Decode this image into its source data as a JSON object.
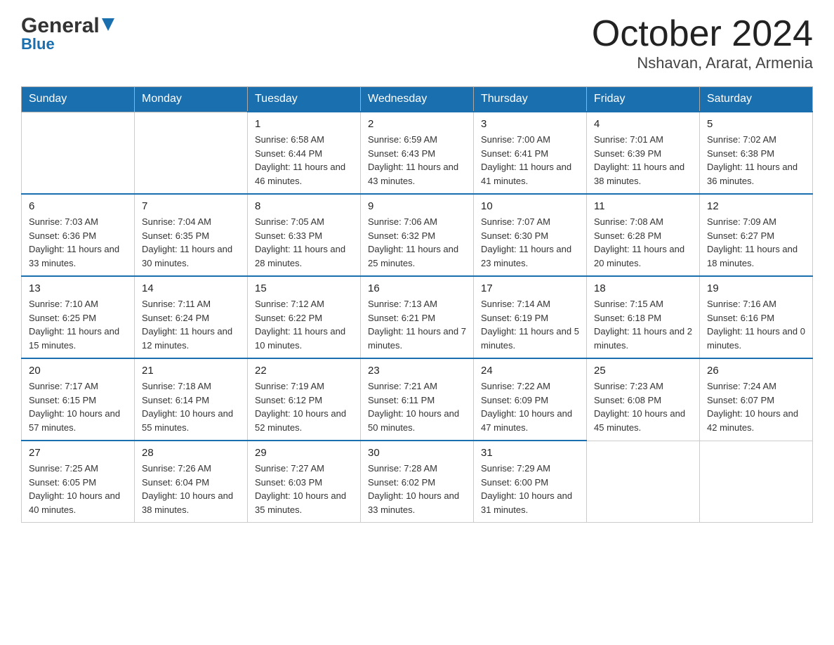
{
  "header": {
    "logo_general": "General",
    "logo_blue": "Blue",
    "month_title": "October 2024",
    "location": "Nshavan, Ararat, Armenia"
  },
  "weekdays": [
    "Sunday",
    "Monday",
    "Tuesday",
    "Wednesday",
    "Thursday",
    "Friday",
    "Saturday"
  ],
  "weeks": [
    [
      {
        "day": "",
        "sunrise": "",
        "sunset": "",
        "daylight": ""
      },
      {
        "day": "",
        "sunrise": "",
        "sunset": "",
        "daylight": ""
      },
      {
        "day": "1",
        "sunrise": "Sunrise: 6:58 AM",
        "sunset": "Sunset: 6:44 PM",
        "daylight": "Daylight: 11 hours and 46 minutes."
      },
      {
        "day": "2",
        "sunrise": "Sunrise: 6:59 AM",
        "sunset": "Sunset: 6:43 PM",
        "daylight": "Daylight: 11 hours and 43 minutes."
      },
      {
        "day": "3",
        "sunrise": "Sunrise: 7:00 AM",
        "sunset": "Sunset: 6:41 PM",
        "daylight": "Daylight: 11 hours and 41 minutes."
      },
      {
        "day": "4",
        "sunrise": "Sunrise: 7:01 AM",
        "sunset": "Sunset: 6:39 PM",
        "daylight": "Daylight: 11 hours and 38 minutes."
      },
      {
        "day": "5",
        "sunrise": "Sunrise: 7:02 AM",
        "sunset": "Sunset: 6:38 PM",
        "daylight": "Daylight: 11 hours and 36 minutes."
      }
    ],
    [
      {
        "day": "6",
        "sunrise": "Sunrise: 7:03 AM",
        "sunset": "Sunset: 6:36 PM",
        "daylight": "Daylight: 11 hours and 33 minutes."
      },
      {
        "day": "7",
        "sunrise": "Sunrise: 7:04 AM",
        "sunset": "Sunset: 6:35 PM",
        "daylight": "Daylight: 11 hours and 30 minutes."
      },
      {
        "day": "8",
        "sunrise": "Sunrise: 7:05 AM",
        "sunset": "Sunset: 6:33 PM",
        "daylight": "Daylight: 11 hours and 28 minutes."
      },
      {
        "day": "9",
        "sunrise": "Sunrise: 7:06 AM",
        "sunset": "Sunset: 6:32 PM",
        "daylight": "Daylight: 11 hours and 25 minutes."
      },
      {
        "day": "10",
        "sunrise": "Sunrise: 7:07 AM",
        "sunset": "Sunset: 6:30 PM",
        "daylight": "Daylight: 11 hours and 23 minutes."
      },
      {
        "day": "11",
        "sunrise": "Sunrise: 7:08 AM",
        "sunset": "Sunset: 6:28 PM",
        "daylight": "Daylight: 11 hours and 20 minutes."
      },
      {
        "day": "12",
        "sunrise": "Sunrise: 7:09 AM",
        "sunset": "Sunset: 6:27 PM",
        "daylight": "Daylight: 11 hours and 18 minutes."
      }
    ],
    [
      {
        "day": "13",
        "sunrise": "Sunrise: 7:10 AM",
        "sunset": "Sunset: 6:25 PM",
        "daylight": "Daylight: 11 hours and 15 minutes."
      },
      {
        "day": "14",
        "sunrise": "Sunrise: 7:11 AM",
        "sunset": "Sunset: 6:24 PM",
        "daylight": "Daylight: 11 hours and 12 minutes."
      },
      {
        "day": "15",
        "sunrise": "Sunrise: 7:12 AM",
        "sunset": "Sunset: 6:22 PM",
        "daylight": "Daylight: 11 hours and 10 minutes."
      },
      {
        "day": "16",
        "sunrise": "Sunrise: 7:13 AM",
        "sunset": "Sunset: 6:21 PM",
        "daylight": "Daylight: 11 hours and 7 minutes."
      },
      {
        "day": "17",
        "sunrise": "Sunrise: 7:14 AM",
        "sunset": "Sunset: 6:19 PM",
        "daylight": "Daylight: 11 hours and 5 minutes."
      },
      {
        "day": "18",
        "sunrise": "Sunrise: 7:15 AM",
        "sunset": "Sunset: 6:18 PM",
        "daylight": "Daylight: 11 hours and 2 minutes."
      },
      {
        "day": "19",
        "sunrise": "Sunrise: 7:16 AM",
        "sunset": "Sunset: 6:16 PM",
        "daylight": "Daylight: 11 hours and 0 minutes."
      }
    ],
    [
      {
        "day": "20",
        "sunrise": "Sunrise: 7:17 AM",
        "sunset": "Sunset: 6:15 PM",
        "daylight": "Daylight: 10 hours and 57 minutes."
      },
      {
        "day": "21",
        "sunrise": "Sunrise: 7:18 AM",
        "sunset": "Sunset: 6:14 PM",
        "daylight": "Daylight: 10 hours and 55 minutes."
      },
      {
        "day": "22",
        "sunrise": "Sunrise: 7:19 AM",
        "sunset": "Sunset: 6:12 PM",
        "daylight": "Daylight: 10 hours and 52 minutes."
      },
      {
        "day": "23",
        "sunrise": "Sunrise: 7:21 AM",
        "sunset": "Sunset: 6:11 PM",
        "daylight": "Daylight: 10 hours and 50 minutes."
      },
      {
        "day": "24",
        "sunrise": "Sunrise: 7:22 AM",
        "sunset": "Sunset: 6:09 PM",
        "daylight": "Daylight: 10 hours and 47 minutes."
      },
      {
        "day": "25",
        "sunrise": "Sunrise: 7:23 AM",
        "sunset": "Sunset: 6:08 PM",
        "daylight": "Daylight: 10 hours and 45 minutes."
      },
      {
        "day": "26",
        "sunrise": "Sunrise: 7:24 AM",
        "sunset": "Sunset: 6:07 PM",
        "daylight": "Daylight: 10 hours and 42 minutes."
      }
    ],
    [
      {
        "day": "27",
        "sunrise": "Sunrise: 7:25 AM",
        "sunset": "Sunset: 6:05 PM",
        "daylight": "Daylight: 10 hours and 40 minutes."
      },
      {
        "day": "28",
        "sunrise": "Sunrise: 7:26 AM",
        "sunset": "Sunset: 6:04 PM",
        "daylight": "Daylight: 10 hours and 38 minutes."
      },
      {
        "day": "29",
        "sunrise": "Sunrise: 7:27 AM",
        "sunset": "Sunset: 6:03 PM",
        "daylight": "Daylight: 10 hours and 35 minutes."
      },
      {
        "day": "30",
        "sunrise": "Sunrise: 7:28 AM",
        "sunset": "Sunset: 6:02 PM",
        "daylight": "Daylight: 10 hours and 33 minutes."
      },
      {
        "day": "31",
        "sunrise": "Sunrise: 7:29 AM",
        "sunset": "Sunset: 6:00 PM",
        "daylight": "Daylight: 10 hours and 31 minutes."
      },
      {
        "day": "",
        "sunrise": "",
        "sunset": "",
        "daylight": ""
      },
      {
        "day": "",
        "sunrise": "",
        "sunset": "",
        "daylight": ""
      }
    ]
  ]
}
